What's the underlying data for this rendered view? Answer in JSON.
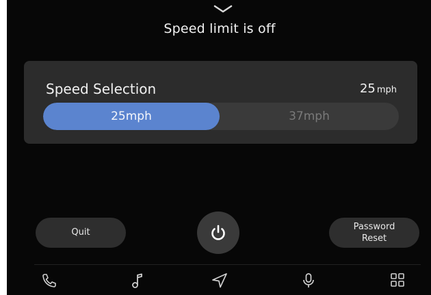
{
  "header": {
    "title": "Speed limit is off"
  },
  "speed_card": {
    "title": "Speed Selection",
    "current_value": "25",
    "current_unit": "mph",
    "options": [
      "25mph",
      "37mph"
    ],
    "selected_index": 0
  },
  "actions": {
    "quit_label": "Quit",
    "password_reset_line1": "Password",
    "password_reset_line2": "Reset"
  },
  "nav": {
    "icons": [
      "phone-icon",
      "music-icon",
      "navigation-icon",
      "microphone-icon",
      "apps-grid-icon"
    ]
  },
  "colors": {
    "background": "#070707",
    "card": "#2c2c2c",
    "accent": "#5b84cf",
    "button": "#2e2e2e"
  }
}
